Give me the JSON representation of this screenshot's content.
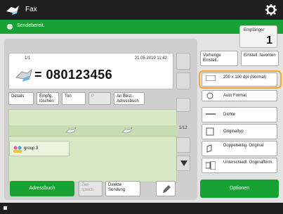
{
  "app": {
    "title": "Fax"
  },
  "status": {
    "text": "Sendebereit."
  },
  "recipients": {
    "label": "Empfänger",
    "count": "1"
  },
  "destination": {
    "index": "1/1",
    "datetime": "21.05.2019 11:42",
    "number": "= 080123456"
  },
  "actions": {
    "details": "Details",
    "recipient_edit": "Empfg. löschen",
    "tone": "Ton",
    "pause": "P",
    "to_addressbook": "An Best.-Adressbuch"
  },
  "list": {
    "page": "1/12",
    "group_label": "group 3"
  },
  "bottom": {
    "addressbook": "Adressbuch",
    "direct_send": "Direkte Sendung",
    "onetouch_label": "Ziel-speich."
  },
  "settings": {
    "prev_settings": "Vorherige Einstell.",
    "favorites": "Einstell. favoriten",
    "resolution": "200 x 100 dpi (Normal)",
    "auto_format": "Auto Format",
    "density": "Dichte",
    "original_type": "Originaltyp",
    "duplex": "Doppelseitig. Original",
    "diff_size": "Unterschiedl. Originalform."
  },
  "options": {
    "label": "Optionen"
  },
  "colors": {
    "accent": "#18a233",
    "highlight": "#f5a623"
  }
}
